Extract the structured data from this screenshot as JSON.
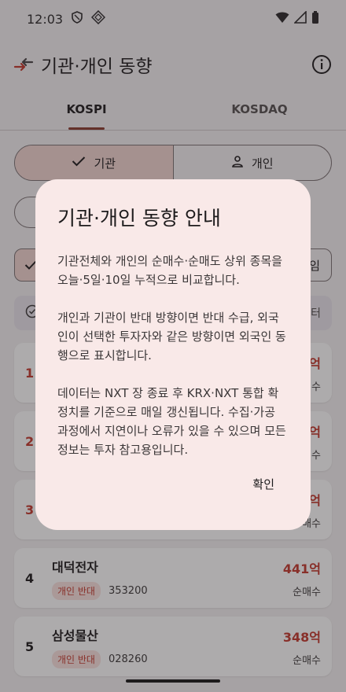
{
  "status_bar": {
    "time": "12:03"
  },
  "app_bar": {
    "title": "기관·개인 동향"
  },
  "tabs": [
    {
      "label": "KOSPI"
    },
    {
      "label": "KOSDAQ"
    }
  ],
  "segment": {
    "institution": "기관",
    "individual": "개인"
  },
  "row3": {
    "right_fragment": "임"
  },
  "notice": {
    "tail": "터"
  },
  "list": [
    {
      "rank": "1",
      "amount_fragment": "억",
      "kind_fragment": "매수"
    },
    {
      "rank": "2",
      "amount_fragment": "억",
      "kind_fragment": "매수"
    },
    {
      "rank": "3",
      "amount_fragment": "억",
      "kind_fragment": "매수"
    },
    {
      "rank": "4",
      "name": "대덕전자",
      "badge": "개인 반대",
      "code": "353200",
      "amount": "441억",
      "kind": "순매수"
    },
    {
      "rank": "5",
      "name": "삼성물산",
      "badge": "개인 반대",
      "code": "028260",
      "amount": "348억",
      "kind": "순매수"
    }
  ],
  "dialog": {
    "title": "기관·개인 동향 안내",
    "paragraphs": [
      "기관전체와 개인의 순매수·순매도 상위 종목을 오늘·5일·10일 누적으로 비교합니다.",
      "개인과 기관이 반대 방향이면 반대 수급, 외국인이 선택한 투자자와 같은 방향이면 외국인 동행으로 표시합니다.",
      "데이터는 NXT 장 종료 후 KRX·NXT 통합 확정치를 기준으로 매일 갱신됩니다. 수집·가공 과정에서 지연이나 오류가 있을 수 있으며 모든 정보는 투자 참고용입니다."
    ],
    "ok_label": "확인"
  },
  "colors": {
    "accent": "#8a3a2e",
    "up": "#c4382c",
    "dialog_bg": "#f9e9e8"
  }
}
